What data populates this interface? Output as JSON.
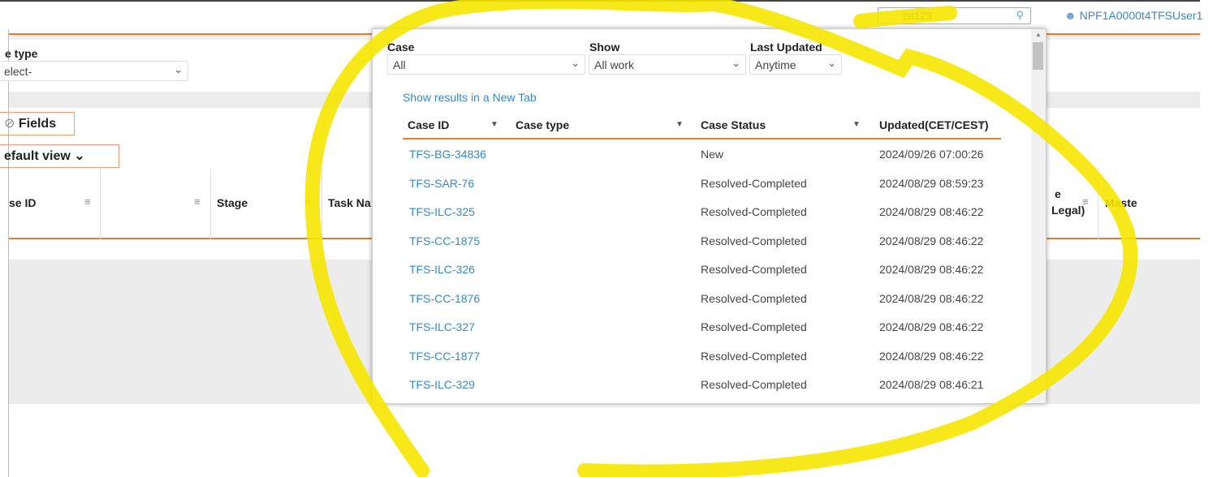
{
  "header": {
    "search_value": "tst123",
    "user": "NPF1A0000t4TFSUser1"
  },
  "background": {
    "case_type_label": "e type",
    "case_type_value": "elect-",
    "fields_button": "Fields",
    "view_button": "efault view",
    "columns": [
      "se ID",
      "",
      "Stage",
      "Task Na",
      "e",
      "Legal)",
      "Maste"
    ]
  },
  "popup": {
    "filters": {
      "case_label": "Case",
      "case_value": "All",
      "show_label": "Show",
      "show_value": "All work",
      "updated_label": "Last Updated",
      "updated_value": "Anytime"
    },
    "new_tab_link": "Show results in a New Tab",
    "columns": [
      "Case ID",
      "Case type",
      "Case Status",
      "Updated(CET/CEST)"
    ],
    "rows": [
      {
        "id": "TFS-BG-34836",
        "type": "",
        "status": "New",
        "updated": "2024/09/26 07:00:26"
      },
      {
        "id": "TFS-SAR-76",
        "type": "",
        "status": "Resolved-Completed",
        "updated": "2024/08/29 08:59:23"
      },
      {
        "id": "TFS-ILC-325",
        "type": "",
        "status": "Resolved-Completed",
        "updated": "2024/08/29 08:46:22"
      },
      {
        "id": "TFS-CC-1875",
        "type": "",
        "status": "Resolved-Completed",
        "updated": "2024/08/29 08:46:22"
      },
      {
        "id": "TFS-ILC-326",
        "type": "",
        "status": "Resolved-Completed",
        "updated": "2024/08/29 08:46:22"
      },
      {
        "id": "TFS-CC-1876",
        "type": "",
        "status": "Resolved-Completed",
        "updated": "2024/08/29 08:46:22"
      },
      {
        "id": "TFS-ILC-327",
        "type": "",
        "status": "Resolved-Completed",
        "updated": "2024/08/29 08:46:22"
      },
      {
        "id": "TFS-CC-1877",
        "type": "",
        "status": "Resolved-Completed",
        "updated": "2024/08/29 08:46:22"
      },
      {
        "id": "TFS-ILC-329",
        "type": "",
        "status": "Resolved-Completed",
        "updated": "2024/08/29 08:46:21"
      }
    ]
  },
  "colors": {
    "accent": "#f07a2a",
    "link": "#3a87c4",
    "annotation": "#f5e600"
  }
}
